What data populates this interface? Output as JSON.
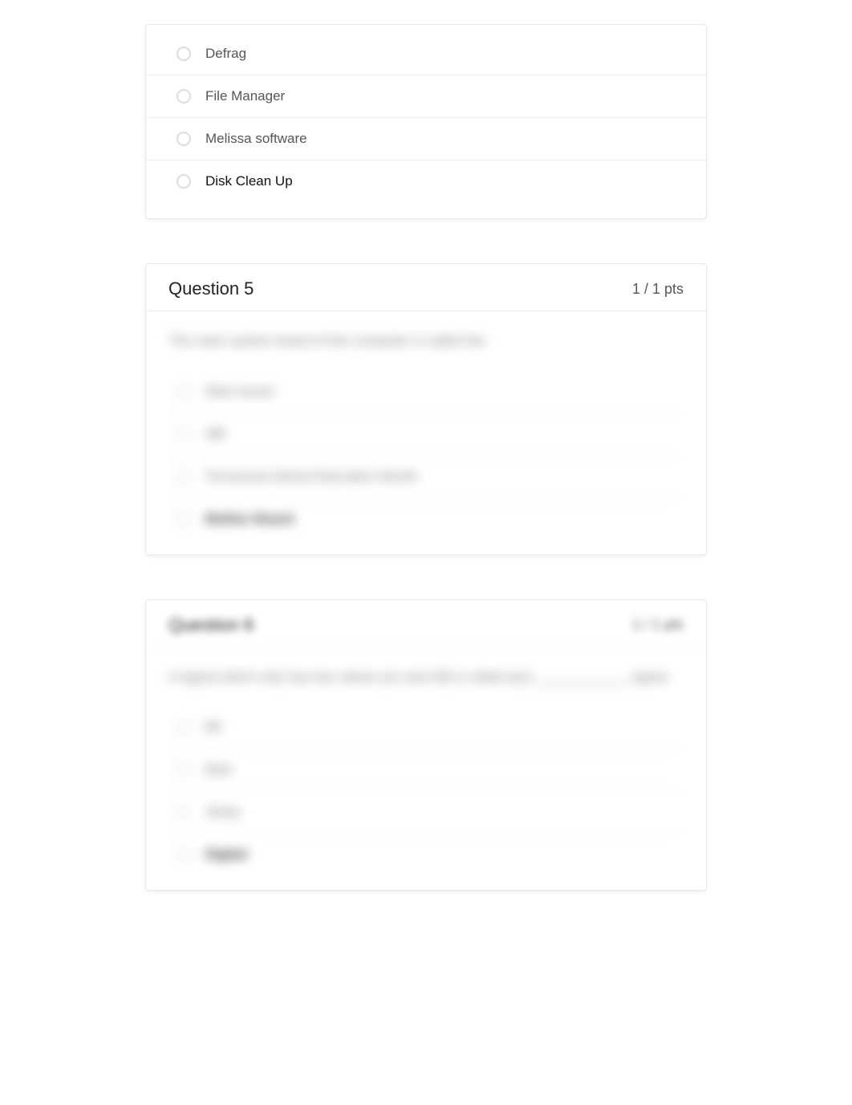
{
  "question4_partial": {
    "options": [
      {
        "label": "Defrag",
        "selected": false
      },
      {
        "label": "File Manager",
        "selected": false
      },
      {
        "label": "Melissa software",
        "selected": false
      },
      {
        "label": "Disk Clean Up",
        "selected": true
      }
    ]
  },
  "question5": {
    "title": "Question 5",
    "points": "1 / 1 pts",
    "prompt": "The main system board of the computer is called the",
    "options": [
      {
        "label": "Main board",
        "selected": false
      },
      {
        "label": "MB",
        "selected": false
      },
      {
        "label": "Tennessee Board Education Month",
        "selected": false
      },
      {
        "label": "Mother Board",
        "selected": true
      }
    ]
  },
  "question6": {
    "title": "Question 6",
    "points": "1 / 1 pts",
    "prompt": "A signal which only has two values (on and off) is called a(n) ____________ signal.",
    "options": [
      {
        "label": "Bit",
        "selected": false
      },
      {
        "label": "Byte",
        "selected": false
      },
      {
        "label": "Sleep",
        "selected": false
      },
      {
        "label": "Digital",
        "selected": true
      }
    ]
  }
}
